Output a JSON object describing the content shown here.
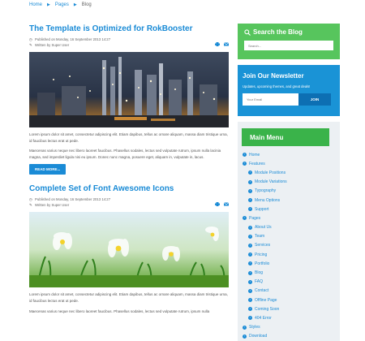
{
  "breadcrumb": {
    "home": "Home",
    "pages": "Pages",
    "current": "Blog"
  },
  "articles": [
    {
      "title": "The Template is Optimized for RokBooster",
      "published": "Published on Monday, 16 September 2013 14:27",
      "author": "Written by Super User",
      "image": "industrial-refinery-night-photo",
      "para1": "Lorem ipsum dolor sit amet, consectetur adipiscing elit. Etiam dapibus, tellus ac ornare aliquam, massa diam tristique urna, id faucibus lectus erat ut pede.",
      "para2": "Maecenas varius neque nec libero laoreet faucibus. Phasellus sodales, lectus sed vulputate rutrum, ipsum nulla lacinia magna, sed imperdiet ligula nisi eu ipsum. Donec nunc magna, posuere eget, aliquam in, vulputate in, lacus.",
      "readmore": "READ MORE..."
    },
    {
      "title": "Complete Set of Font Awesome Icons",
      "published": "Published on Monday, 16 September 2013 14:27",
      "author": "Written by Super User",
      "image": "daisy-flowers-grass-photo",
      "para1": "Lorem ipsum dolor sit amet, consectetur adipiscing elit. Etiam dapibus, tellus ac ornare aliquam, massa diam tristique urna, id faucibus lectus erat ut pede.",
      "para2": "Maecenas varius neque nec libero laoreet faucibus. Phasellus sodales, lectus sed vulputate rutrum, ipsum nulla"
    }
  ],
  "sidebar": {
    "search": {
      "title": "Search the Blog",
      "placeholder": "Search..."
    },
    "newsletter": {
      "title": "Join Our Newsletter",
      "desc": "Updates, upcoming themes, and great deals!",
      "email_placeholder": "Your Email",
      "join_label": "JOIN"
    },
    "menu": {
      "title": "Main Menu",
      "items": [
        {
          "label": "Home",
          "level": 1
        },
        {
          "label": "Features",
          "level": 1
        },
        {
          "label": "Module Positions",
          "level": 2
        },
        {
          "label": "Module Variations",
          "level": 2
        },
        {
          "label": "Typography",
          "level": 2
        },
        {
          "label": "Menu Options",
          "level": 2
        },
        {
          "label": "Support",
          "level": 2
        },
        {
          "label": "Pages",
          "level": 1
        },
        {
          "label": "About Us",
          "level": 2
        },
        {
          "label": "Team",
          "level": 2
        },
        {
          "label": "Services",
          "level": 2
        },
        {
          "label": "Pricing",
          "level": 2
        },
        {
          "label": "Portfolio",
          "level": 2
        },
        {
          "label": "Blog",
          "level": 2
        },
        {
          "label": "FAQ",
          "level": 2
        },
        {
          "label": "Contact",
          "level": 2
        },
        {
          "label": "Offline Page",
          "level": 2
        },
        {
          "label": "Coming Soon",
          "level": 2
        },
        {
          "label": "404 Error",
          "level": 2
        },
        {
          "label": "Styles",
          "level": 1
        },
        {
          "label": "Download",
          "level": 1
        }
      ]
    }
  },
  "colors": {
    "accent": "#1a8bd6",
    "green": "#57c55d",
    "menu_green": "#3ab34a",
    "newsletter_blue": "#1a93d6"
  }
}
